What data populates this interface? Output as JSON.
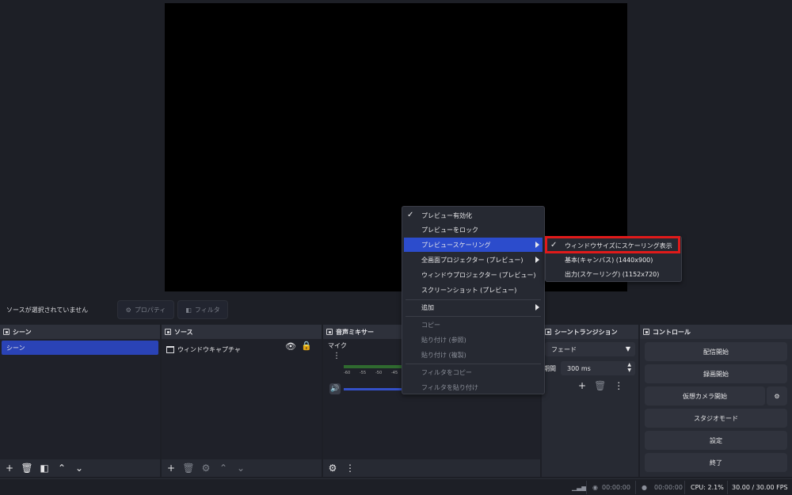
{
  "source_toolbar": {
    "no_source": "ソースが選択されていません",
    "properties": "プロパティ",
    "filters": "フィルタ"
  },
  "docks": {
    "scenes": {
      "title": "シーン",
      "items": [
        "シーン"
      ]
    },
    "sources": {
      "title": "ソース",
      "items": [
        "ウィンドウキャプチャ"
      ]
    },
    "mixer": {
      "title": "音声ミキサー",
      "channel": "マイク",
      "scale": [
        "-60",
        "-55",
        "-50",
        "-45"
      ]
    },
    "transitions": {
      "title": "シーントランジション",
      "type": "フェード",
      "duration_label": "期間",
      "duration": "300 ms"
    },
    "controls": {
      "title": "コントロール",
      "buttons": [
        "配信開始",
        "録画開始",
        "仮想カメラ開始",
        "スタジオモード",
        "設定",
        "終了"
      ]
    }
  },
  "status_bar": {
    "stream_time": "00:00:00",
    "record_time": "00:00:00",
    "cpu": "CPU: 2.1%",
    "fps": "30.00 / 30.00 FPS"
  },
  "context_menu": {
    "items": [
      {
        "label": "プレビュー有効化",
        "checked": true
      },
      {
        "label": "プレビューをロック"
      },
      {
        "label": "プレビュースケーリング",
        "submenu": true,
        "active": true
      },
      {
        "label": "全画面プロジェクター (プレビュー)",
        "submenu": true
      },
      {
        "label": "ウィンドウプロジェクター (プレビュー)"
      },
      {
        "label": "スクリーンショット (プレビュー)"
      },
      {
        "label": "追加",
        "submenu": true
      },
      {
        "label": "コピー",
        "disabled": true
      },
      {
        "label": "貼り付け (参照)",
        "disabled": true
      },
      {
        "label": "貼り付け (複製)",
        "disabled": true
      },
      {
        "label": "フィルタをコピー",
        "disabled": true
      },
      {
        "label": "フィルタを貼り付け",
        "disabled": true
      }
    ],
    "submenu": [
      {
        "label": "ウィンドウサイズにスケーリング表示",
        "checked": true
      },
      {
        "label": "基本(キャンバス) (1440x900)"
      },
      {
        "label": "出力(スケーリング) (1152x720)"
      }
    ]
  },
  "colors": {
    "accent": "#2c4ccc",
    "highlight": "#e01a1a",
    "scene_selected": "#2a43b6"
  }
}
